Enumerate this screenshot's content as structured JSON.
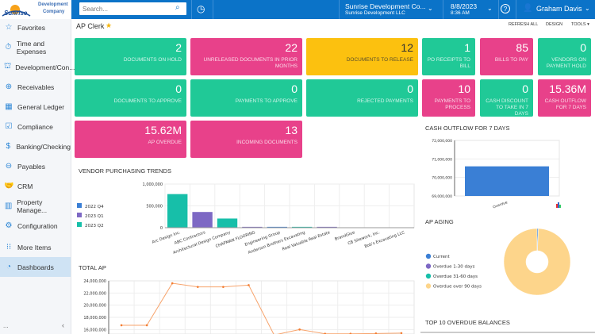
{
  "logo": {
    "text": "Sunrise",
    "sub1": "Development",
    "sub2": "Company"
  },
  "header": {
    "search_placeholder": "Search...",
    "company": "Sunrise Development Co...",
    "branch": "Sunrise Development LLC",
    "date": "8/8/2023",
    "time": "8:36 AM",
    "user": "Graham Davis"
  },
  "sidebar": {
    "items": [
      {
        "label": "Favorites",
        "icon": "star-icon"
      },
      {
        "label": "Time and Expenses",
        "icon": "stopwatch-icon"
      },
      {
        "label": "Development/Con...",
        "icon": "crane-icon"
      },
      {
        "label": "Receivables",
        "icon": "plus-circle-icon"
      },
      {
        "label": "General Ledger",
        "icon": "calculator-icon"
      },
      {
        "label": "Compliance",
        "icon": "checklist-icon"
      },
      {
        "label": "Banking/Checking",
        "icon": "dollar-icon"
      },
      {
        "label": "Payables",
        "icon": "minus-circle-icon"
      },
      {
        "label": "CRM",
        "icon": "handshake-icon"
      },
      {
        "label": "Property Manage...",
        "icon": "building-icon"
      },
      {
        "label": "Configuration",
        "icon": "gear-icon"
      },
      {
        "label": "More Items",
        "icon": "grid-icon"
      },
      {
        "label": "Dashboards",
        "icon": "gauge-icon",
        "active": true
      }
    ],
    "more": "...",
    "collapse": "‹"
  },
  "page": {
    "title": "AP Clerk",
    "refresh": "REFRESH ALL",
    "design": "DESIGN",
    "tools": "TOOLS"
  },
  "tiles": [
    {
      "value": "2",
      "label": "Documents on hold",
      "color": "g"
    },
    {
      "value": "22",
      "label": "Unreleased documents in prior months",
      "color": "p"
    },
    {
      "value": "12",
      "label": "Documents to release",
      "color": "y"
    },
    {
      "value": "1",
      "label": "PO receipts to bill",
      "color": "g"
    },
    {
      "value": "85",
      "label": "Bills to pay",
      "color": "p"
    },
    {
      "value": "0",
      "label": "Vendors on payment hold",
      "color": "g"
    },
    {
      "value": "0",
      "label": "Documents to approve",
      "color": "g"
    },
    {
      "value": "0",
      "label": "Payments to approve",
      "color": "g"
    },
    {
      "value": "0",
      "label": "Rejected payments",
      "color": "g"
    },
    {
      "value": "10",
      "label": "Payments to process",
      "color": "p"
    },
    {
      "value": "0",
      "label": "Cash discount to take in 7 days",
      "color": "g"
    },
    {
      "value": "15.36M",
      "label": "Cash outflow for 7 days",
      "color": "p"
    },
    {
      "value": "15.62M",
      "label": "AP overdue",
      "color": "p"
    },
    {
      "value": "13",
      "label": "Incoming documents",
      "color": "p"
    }
  ],
  "chart_data": [
    {
      "type": "bar",
      "title": "VENDOR PURCHASING TRENDS",
      "categories": [
        "Arc Design Inc.",
        "ABC Contractors",
        "Architectural Design Company",
        "CHAPMAN FLOORING",
        "Engineering Group",
        "Anderson Brothers Excavating",
        "Real Valuable Real Estate",
        "BrandGlue",
        "CB Sitework, Inc.",
        "Bob's Excavating LLC"
      ],
      "series": [
        {
          "name": "2022 Q4",
          "color": "#3a7fd5",
          "values": [
            0,
            0,
            0,
            0,
            20000,
            0,
            0,
            0,
            0,
            0
          ]
        },
        {
          "name": "2023 Q1",
          "color": "#7d68c4",
          "values": [
            0,
            360000,
            0,
            20000,
            0,
            0,
            20000,
            0,
            0,
            0
          ]
        },
        {
          "name": "2023 Q2",
          "color": "#17bfa9",
          "values": [
            770000,
            0,
            210000,
            0,
            0,
            20000,
            0,
            0,
            0,
            0
          ]
        }
      ],
      "ylim": [
        0,
        1000000
      ],
      "yticks": [
        "0",
        "500,000",
        "1,000,000"
      ],
      "legend": "left",
      "grid": true
    },
    {
      "type": "bar",
      "title": "CASH OUTFLOW FOR 7 DAYS",
      "categories": [
        "Overdue"
      ],
      "values": [
        70600000
      ],
      "color": "#3a7fd5",
      "ylim": [
        69000000,
        72000000
      ],
      "yticks": [
        "69,000,000",
        "70,000,000",
        "71,000,000",
        "72,000,000"
      ],
      "grid": true
    },
    {
      "type": "pie",
      "title": "AP AGING",
      "donut": true,
      "labels": [
        "Current",
        "Overdue 1-30 days",
        "Overdue 31-60 days",
        "Overdue over 90 days"
      ],
      "colors": [
        "#3a7fd5",
        "#7d68c4",
        "#17bfa9",
        "#fdd58b"
      ],
      "values": [
        0.6,
        0,
        0,
        99.4
      ],
      "legend": "left"
    },
    {
      "type": "line",
      "title": "TOTAL AP",
      "values": [
        16700000,
        16700000,
        23600000,
        23000000,
        23000000,
        23300000,
        15100000,
        16000000,
        15300000,
        15300000,
        15350000,
        15400000
      ],
      "color": "#f7a36b",
      "ylim": [
        15000000,
        24000000
      ],
      "yticks": [
        "16,000,000",
        "18,000,000",
        "20,000,000",
        "22,000,000",
        "24,000,000"
      ],
      "grid": true
    }
  ],
  "top10_title": "TOP 10 OVERDUE BALANCES"
}
